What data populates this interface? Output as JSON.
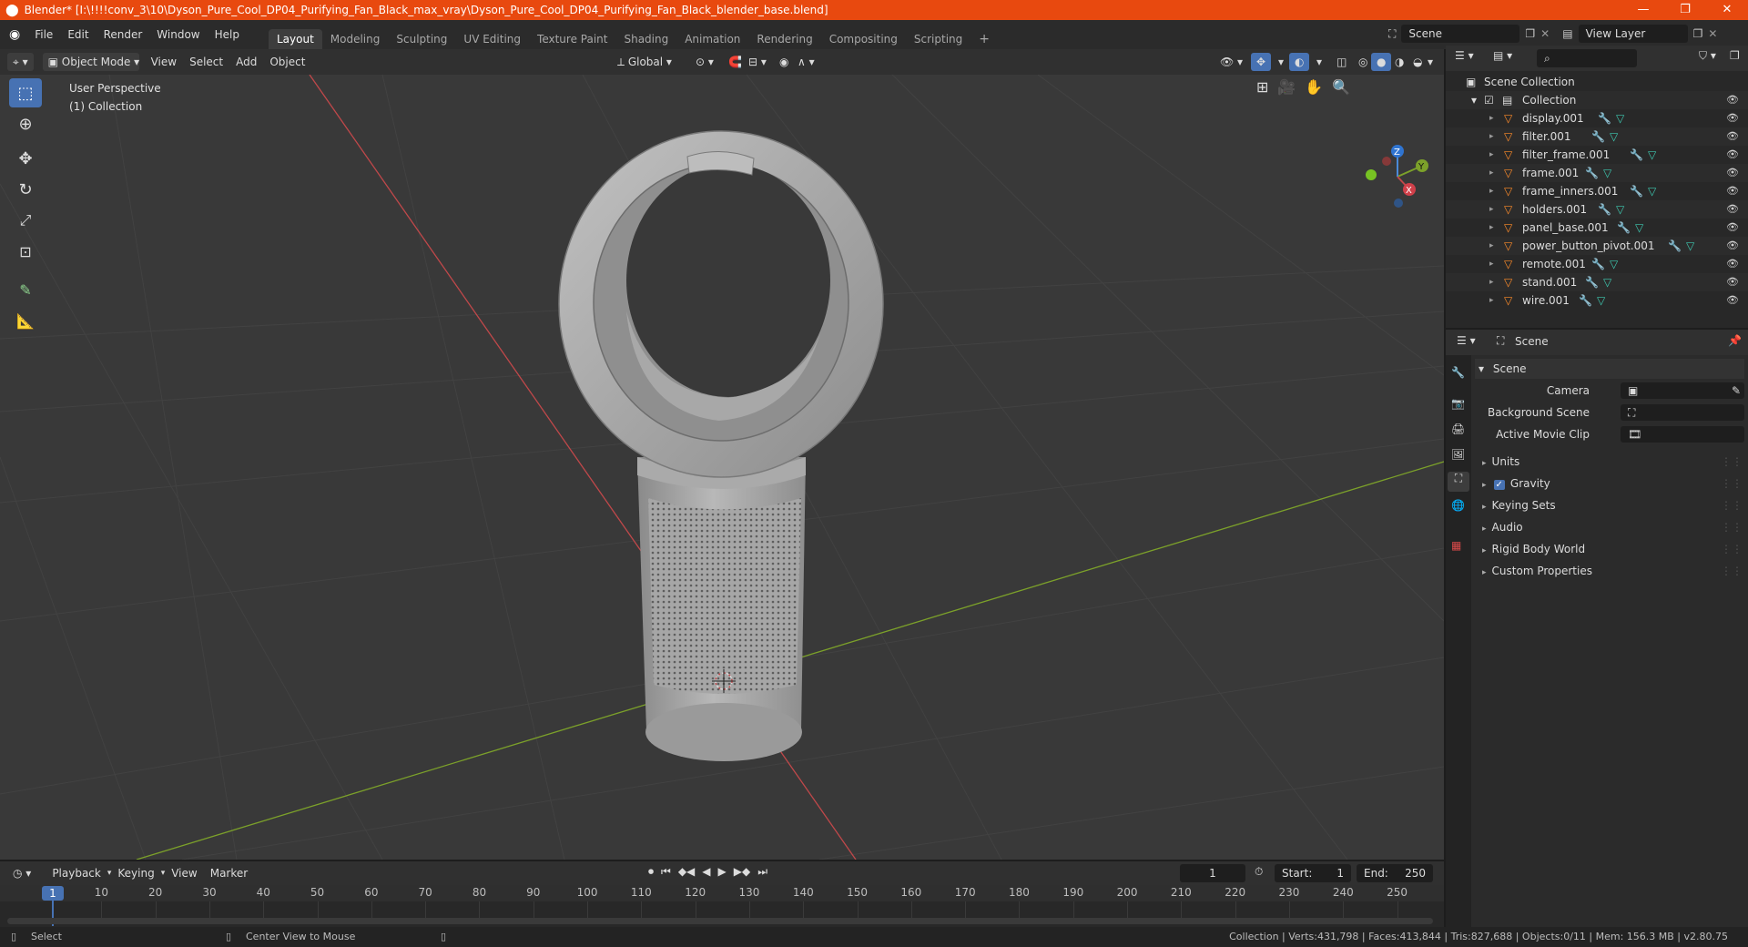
{
  "title_bar": {
    "title": "Blender* [I:\\!!!!conv_3\\10\\Dyson_Pure_Cool_DP04_Purifying_Fan_Black_max_vray\\Dyson_Pure_Cool_DP04_Purifying_Fan_Black_blender_base.blend]",
    "minimize": "—",
    "restore": "❐",
    "close": "✕"
  },
  "menus": [
    "File",
    "Edit",
    "Render",
    "Window",
    "Help"
  ],
  "workspace_tabs": [
    {
      "label": "Layout",
      "active": true
    },
    {
      "label": "Modeling",
      "active": false
    },
    {
      "label": "Sculpting",
      "active": false
    },
    {
      "label": "UV Editing",
      "active": false
    },
    {
      "label": "Texture Paint",
      "active": false
    },
    {
      "label": "Shading",
      "active": false
    },
    {
      "label": "Animation",
      "active": false
    },
    {
      "label": "Rendering",
      "active": false
    },
    {
      "label": "Compositing",
      "active": false
    },
    {
      "label": "Scripting",
      "active": false
    }
  ],
  "add_workspace": "+",
  "scene_field": "Scene",
  "view_layer_field": "View Layer",
  "viewport_header": {
    "mode": "Object Mode",
    "menus": [
      "View",
      "Select",
      "Add",
      "Object"
    ],
    "transform_orientation": "Global"
  },
  "viewport": {
    "perspective_label": "User Perspective",
    "collection_label": "(1) Collection",
    "gizmo": {
      "x": "X",
      "y": "Y",
      "z": "Z"
    }
  },
  "outliner": {
    "root": "Scene Collection",
    "collection": "Collection",
    "objects": [
      "display.001",
      "filter.001",
      "filter_frame.001",
      "frame.001",
      "frame_inners.001",
      "holders.001",
      "panel_base.001",
      "power_button_pivot.001",
      "remote.001",
      "stand.001",
      "wire.001"
    ]
  },
  "properties": {
    "header_title": "Scene",
    "section": "Scene",
    "fields": [
      {
        "label": "Camera",
        "value": ""
      },
      {
        "label": "Background Scene",
        "value": ""
      },
      {
        "label": "Active Movie Clip",
        "value": ""
      }
    ],
    "panels": [
      "Units",
      "Gravity",
      "Keying Sets",
      "Audio",
      "Rigid Body World",
      "Custom Properties"
    ],
    "gravity_checked": true
  },
  "timeline": {
    "menus": [
      "Playback",
      "Keying",
      "View",
      "Marker"
    ],
    "current_frame": "1",
    "start_label": "Start:",
    "start": "1",
    "end_label": "End:",
    "end": "250",
    "ruler_current": "1",
    "ruler_ticks": [
      "10",
      "20",
      "30",
      "40",
      "50",
      "60",
      "70",
      "80",
      "90",
      "100",
      "110",
      "120",
      "130",
      "140",
      "150",
      "160",
      "170",
      "180",
      "190",
      "200",
      "210",
      "220",
      "230",
      "240",
      "250"
    ]
  },
  "status_bar": {
    "left_action": "Select",
    "middle_action": "Center View to Mouse",
    "stats": "Collection | Verts:431,798 | Faces:413,844 | Tris:827,688 | Objects:0/11 | Mem: 156.3 MB | v2.80.75"
  },
  "colors": {
    "title_bar": "#e8490f",
    "active_tool": "#4772b3",
    "axis_x": "#c0484a",
    "axis_y": "#7ca12a",
    "mesh_icon": "#ff8c2a",
    "modifier_icon": "#6aa8ff",
    "data_icon": "#3ec8b0"
  }
}
